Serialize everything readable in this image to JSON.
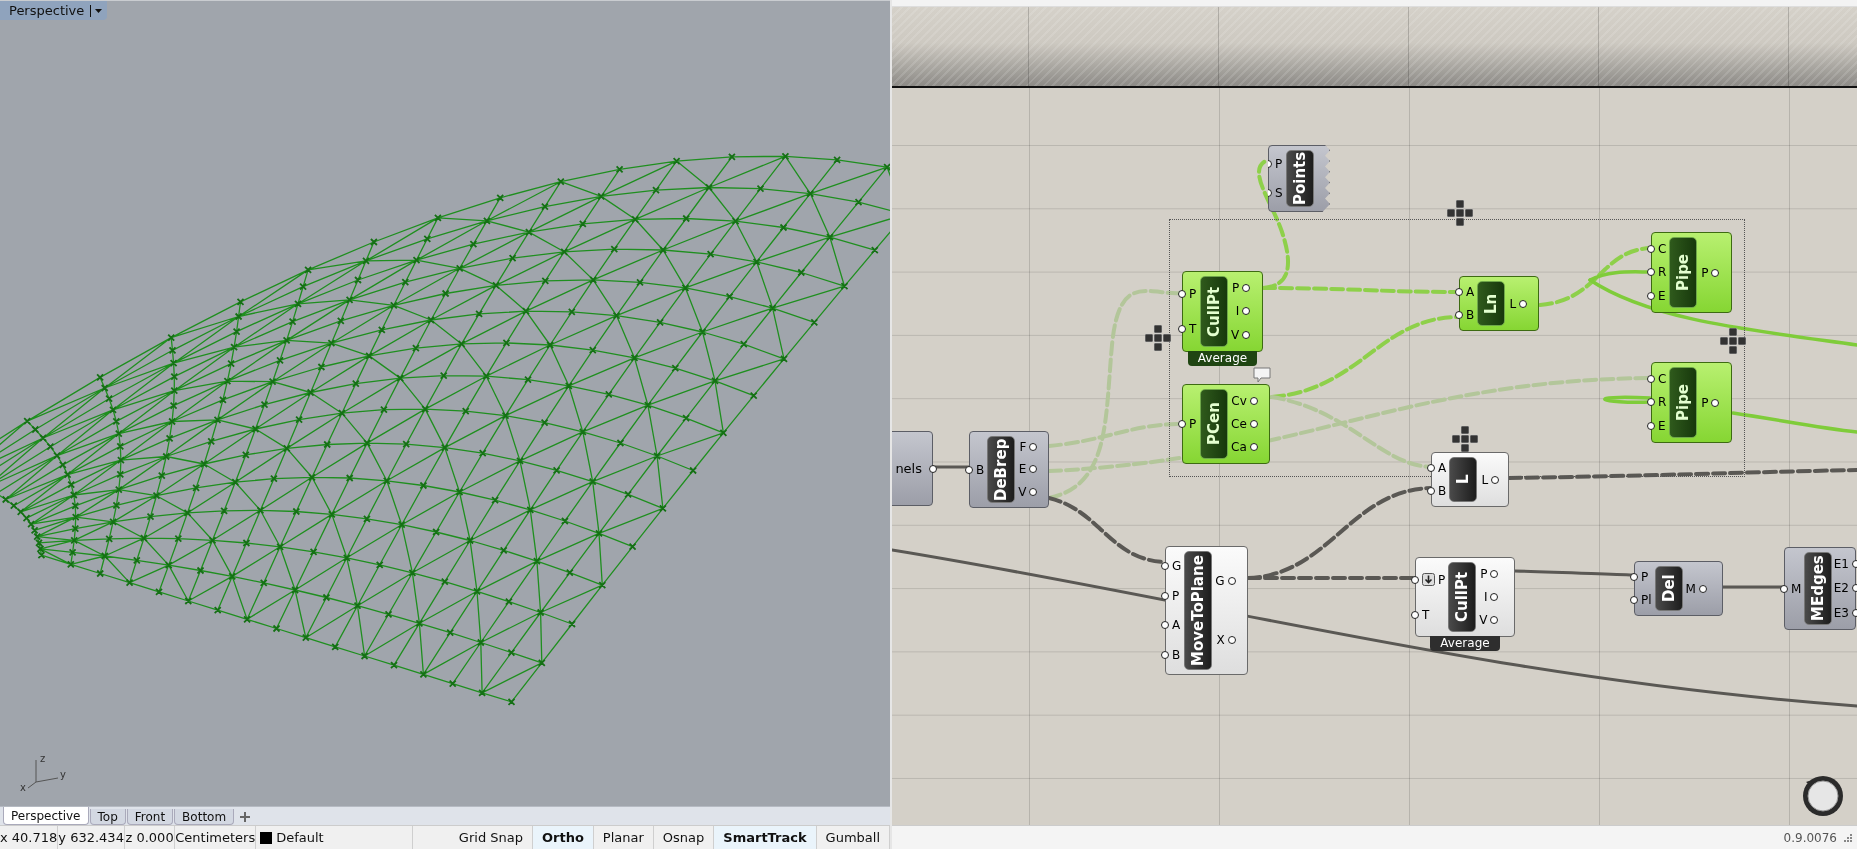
{
  "rhino": {
    "viewport": {
      "title": "Perspective",
      "axis_labels": [
        "z",
        "y",
        "x"
      ]
    },
    "tabs": [
      {
        "label": "Perspective",
        "selected": true
      },
      {
        "label": "Top",
        "selected": false
      },
      {
        "label": "Front",
        "selected": false
      },
      {
        "label": "Bottom",
        "selected": false
      }
    ],
    "status_bar": {
      "coordinates": [
        "x 40.718",
        "y 632.434",
        "z 0.000"
      ],
      "units": "Centimeters",
      "layer": {
        "name": "Default",
        "color": "#000000"
      },
      "toggles": [
        {
          "label": "Grid Snap",
          "on": false
        },
        {
          "label": "Ortho",
          "on": true
        },
        {
          "label": "Planar",
          "on": false
        },
        {
          "label": "Osnap",
          "on": false
        },
        {
          "label": "SmartTrack",
          "on": true
        },
        {
          "label": "Gumball",
          "on": false
        }
      ]
    }
  },
  "grasshopper": {
    "nodes": [
      {
        "kind": "param",
        "title": "Points",
        "inputs": [
          "P",
          "S"
        ],
        "selected": false,
        "preview": false
      },
      {
        "kind": "component",
        "title": "CullPt",
        "inputs": [
          "P",
          "T"
        ],
        "outputs": [
          "P",
          "I",
          "V"
        ],
        "selected": true,
        "preview": true,
        "footer": "Average"
      },
      {
        "kind": "component",
        "title": "Ln",
        "inputs": [
          "A",
          "B"
        ],
        "outputs": [
          "L"
        ],
        "selected": true,
        "preview": true
      },
      {
        "kind": "component",
        "title": "Pipe",
        "inputs": [
          "C",
          "R",
          "E"
        ],
        "outputs": [
          "P"
        ],
        "selected": true,
        "preview": true
      },
      {
        "kind": "component",
        "title": "Pipe",
        "inputs": [
          "C",
          "R",
          "E"
        ],
        "outputs": [
          "P"
        ],
        "selected": true,
        "preview": true
      },
      {
        "kind": "component",
        "title": "PCen",
        "inputs": [
          "P"
        ],
        "outputs": [
          "Cv",
          "Ce",
          "Ca"
        ],
        "selected": true,
        "preview": true
      },
      {
        "kind": "stub",
        "title": "nels",
        "selected": false,
        "preview": false
      },
      {
        "kind": "component",
        "title": "DeBrep",
        "inputs": [
          "B"
        ],
        "outputs": [
          "F",
          "E",
          "V"
        ],
        "selected": false,
        "preview": false
      },
      {
        "kind": "component",
        "title": "L",
        "inputs": [
          "A",
          "B"
        ],
        "outputs": [
          "L"
        ],
        "selected": false,
        "preview": true
      },
      {
        "kind": "component",
        "title": "MoveToPlane",
        "inputs": [
          "G",
          "P",
          "A",
          "B"
        ],
        "outputs": [
          "G",
          "X"
        ],
        "selected": false,
        "preview": true
      },
      {
        "kind": "component",
        "title": "CullPt",
        "inputs": [
          "P",
          "T"
        ],
        "outputs": [
          "P",
          "I",
          "V"
        ],
        "selected": false,
        "preview": true,
        "footer": "Average",
        "flatten_first_input": true
      },
      {
        "kind": "component",
        "title": "Del",
        "inputs": [
          "P",
          "Pl"
        ],
        "outputs": [
          "M"
        ],
        "selected": false,
        "preview": false
      },
      {
        "kind": "component",
        "title": "MEdges",
        "inputs": [
          "M"
        ],
        "outputs": [
          "E1",
          "E2",
          "E3"
        ],
        "selected": false,
        "preview": false
      }
    ],
    "version": "0.9.0076"
  }
}
